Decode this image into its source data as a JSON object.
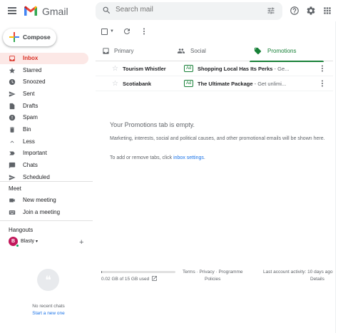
{
  "header": {
    "app_name": "Gmail",
    "search_placeholder": "Search mail",
    "icons": [
      "menu-icon",
      "gmail-logo-icon",
      "search-icon",
      "search-options-icon",
      "help-icon",
      "settings-icon",
      "apps-icon"
    ]
  },
  "sidebar": {
    "compose_label": "Compose",
    "items": [
      {
        "label": "Inbox",
        "icon": "inbox-icon",
        "active": true
      },
      {
        "label": "Starred",
        "icon": "star-icon"
      },
      {
        "label": "Snoozed",
        "icon": "clock-icon"
      },
      {
        "label": "Sent",
        "icon": "send-icon"
      },
      {
        "label": "Drafts",
        "icon": "draft-icon"
      },
      {
        "label": "Spam",
        "icon": "spam-icon"
      },
      {
        "label": "Bin",
        "icon": "bin-icon"
      },
      {
        "label": "Less",
        "icon": "chevron-up-icon"
      },
      {
        "label": "Important",
        "icon": "important-icon"
      },
      {
        "label": "Chats",
        "icon": "chat-icon"
      },
      {
        "label": "Scheduled",
        "icon": "scheduled-icon"
      }
    ],
    "meet": {
      "heading": "Meet",
      "items": [
        {
          "label": "New meeting",
          "icon": "video-icon"
        },
        {
          "label": "Join a meeting",
          "icon": "keyboard-icon"
        }
      ]
    },
    "hangouts": {
      "heading": "Hangouts",
      "user_initial": "B",
      "user_name": "Blasty",
      "user_caret": "▾",
      "add_symbol": "+",
      "no_chats": "No recent chats",
      "start_new": "Start a new one"
    }
  },
  "tabs": [
    {
      "label": "Primary",
      "icon": "inbox-tab-icon",
      "active": false
    },
    {
      "label": "Social",
      "icon": "people-icon",
      "active": false
    },
    {
      "label": "Promotions",
      "icon": "tag-icon",
      "active": true
    }
  ],
  "colors": {
    "accent_red": "#d93025",
    "promotions_green": "#188038",
    "link_blue": "#1a73e8"
  },
  "emails": [
    {
      "sender": "Tourism Whistler",
      "badge": "Ad",
      "subject": "Shopping Local Has Its Perks",
      "snippet": " - Ge..."
    },
    {
      "sender": "Scotiabank",
      "badge": "Ad",
      "subject": "The Ultimate Package",
      "snippet": " - Get unlimi..."
    }
  ],
  "empty_state": {
    "title": "Your Promotions tab is empty.",
    "text": "Marketing, interests, social and political causes, and other promotional emails will be shown here.",
    "settings_prefix": "To add or remove tabs, click ",
    "settings_link": "inbox settings",
    "settings_suffix": "."
  },
  "footer": {
    "storage_used": "0.02 GB of 15 GB used",
    "storage_fraction": 0.0013,
    "links": "Terms · Privacy · Programme",
    "policies": "Policies",
    "activity": "Last account activity: 10 days ago",
    "details": "Details"
  }
}
